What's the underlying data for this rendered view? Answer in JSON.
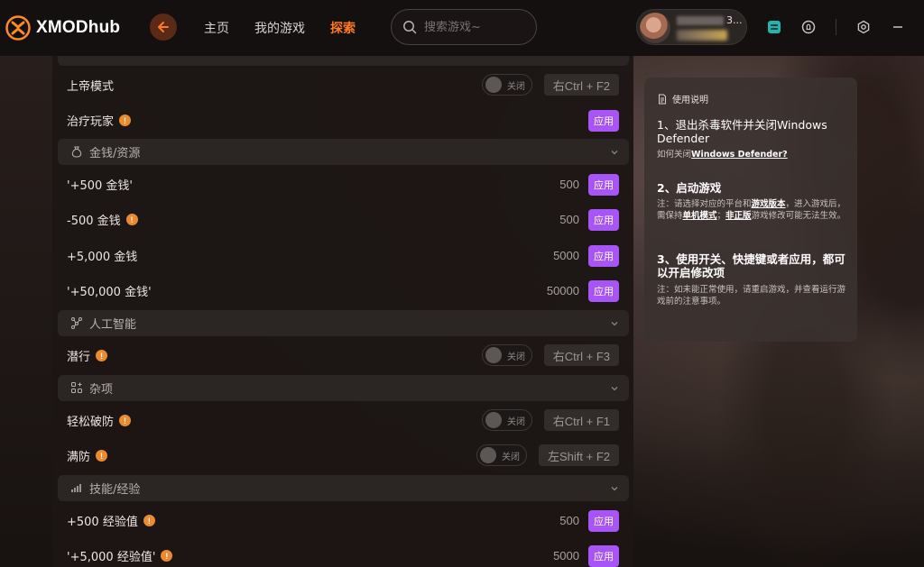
{
  "app": {
    "name": "XMODhub"
  },
  "nav": {
    "items": [
      "主页",
      "我的游戏",
      "探索"
    ],
    "active": "探索"
  },
  "search": {
    "placeholder": "搜索游戏~"
  },
  "user": {
    "name_suffix": "3..."
  },
  "colors": {
    "accent": "#ff7a1a",
    "apply": "#a855f7",
    "info": "#ee8a2e"
  },
  "toggle_off_label": "关闭",
  "apply_label": "应用",
  "panel": {
    "god_mode": {
      "label": "上帝模式",
      "toggle": "关闭",
      "hotkey": "右Ctrl + F2"
    },
    "heal_player": {
      "label": "治疗玩家",
      "button": "应用"
    },
    "money_section": "金钱/资源",
    "money": [
      {
        "label": "'+500 金钱'",
        "value": "500",
        "button": "应用"
      },
      {
        "label": "-500 金钱",
        "value": "500",
        "button": "应用"
      },
      {
        "label": "+5,000 金钱",
        "value": "5000",
        "button": "应用"
      },
      {
        "label": "'+50,000 金钱'",
        "value": "50000",
        "button": "应用"
      }
    ],
    "ai_section": "人工智能",
    "stealth": {
      "label": "潜行",
      "toggle": "关闭",
      "hotkey": "右Ctrl + F3"
    },
    "misc_section": "杂项",
    "easy_break": {
      "label": "轻松破防",
      "toggle": "关闭",
      "hotkey": "右Ctrl + F1"
    },
    "full_defense": {
      "label": "满防",
      "toggle": "关闭",
      "hotkey": "左Shift + F2"
    },
    "skill_section": "技能/经验",
    "exp": [
      {
        "label": "+500 经验值",
        "value": "500",
        "button": "应用"
      },
      {
        "label": "'+5,000 经验值'",
        "value": "5000",
        "button": "应用"
      }
    ]
  },
  "instructions": {
    "title": "使用说明",
    "step1_title": "1、退出杀毒软件并关闭Windows Defender",
    "step1_note_prefix": "如何关闭",
    "step1_note_link": "Windows Defender?",
    "step2_title": "2、启动游戏",
    "step2_note_a": "注：请选择对应的平台和",
    "step2_note_link1": "游戏版本",
    "step2_note_b": "，进入游戏后，需保持",
    "step2_note_link2": "单机模式",
    "step2_note_c": "；",
    "step2_note_link3": "非正版",
    "step2_note_d": "游戏修改可能无法生效。",
    "step3_title": "3、使用开关、快捷键或者应用，都可以开启修改项",
    "step3_note": "注：如未能正常使用，请重启游戏，并查看运行游戏前的注意事项。"
  }
}
